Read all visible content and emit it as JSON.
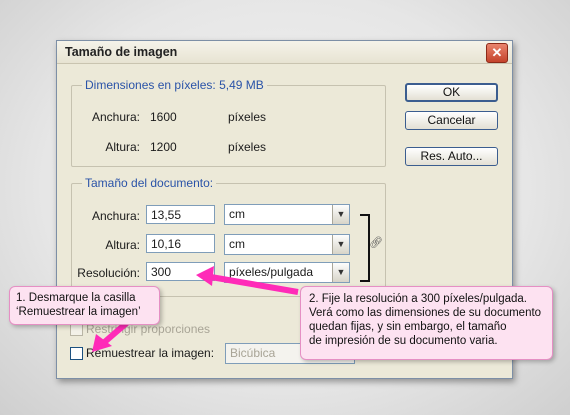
{
  "dialog": {
    "title": "Tamaño de imagen",
    "close_icon": "close-icon"
  },
  "pixel_dimensions": {
    "legend": "Dimensiones en píxeles:  5,49 MB",
    "width_label": "Anchura:",
    "width_value": "1600",
    "width_unit": "píxeles",
    "height_label": "Altura:",
    "height_value": "1200",
    "height_unit": "píxeles"
  },
  "document_size": {
    "legend": "Tamaño del documento:",
    "width_label": "Anchura:",
    "width_value": "13,55",
    "width_unit": "cm",
    "height_label": "Altura:",
    "height_value": "10,16",
    "height_unit": "cm",
    "resolution_label": "Resolución:",
    "resolution_value": "300",
    "resolution_unit": "píxeles/pulgada",
    "link_icon": "chain-link-icon"
  },
  "options": {
    "constrain_label": "Restringir proporciones",
    "resample_label": "Remuestrear la imagen:",
    "resample_method": "Bicúbica"
  },
  "buttons": {
    "ok": "OK",
    "cancel": "Cancelar",
    "auto": "Res. Auto..."
  },
  "callouts": {
    "left": [
      "1. Desmarque la casilla",
      "‘Remuestrear la imagen’"
    ],
    "right": [
      "2. Fije la resolución a 300 píxeles/pulgada.",
      "Verá como las dimensiones de su documento",
      "quedan fijas, y sin embargo, el tamaño",
      "de impresión de su documento varia."
    ]
  },
  "colors": {
    "accent": "#2a53a8",
    "callout_bg": "#fde2f1",
    "arrow": "#ff2bb8"
  }
}
